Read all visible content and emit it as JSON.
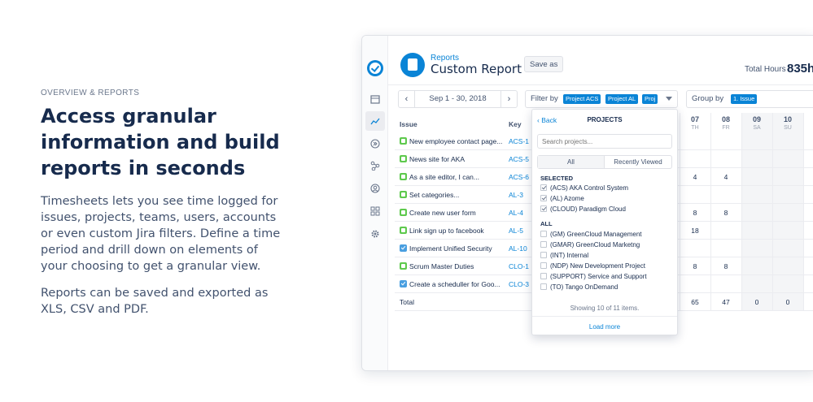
{
  "marketing": {
    "eyebrow": "OVERVIEW & REPORTS",
    "headline": "Access granular information and build reports in seconds",
    "paragraph1": "Timesheets lets you see time logged for issues, projects, teams, users, accounts or even custom Jira filters. Define a time period and drill down on elements of your choosing to get a granular view.",
    "paragraph2": "Reports can be saved and exported as XLS, CSV and PDF."
  },
  "app": {
    "breadcrumb": "Reports",
    "title": "Custom Report",
    "save_as": "Save as",
    "total_hours_label": "Total Hours",
    "total_hours_value": "835h",
    "date_range": "Sep 1 - 30, 2018",
    "filter_label": "Filter by",
    "filter_tags": [
      "Project ACS",
      "Project AL",
      "Proj"
    ],
    "group_label": "Group by",
    "group_tag": "1. Issue",
    "table": {
      "col_issue": "Issue",
      "col_key": "Key",
      "days": [
        {
          "num": "07",
          "name": "TH"
        },
        {
          "num": "08",
          "name": "FR"
        },
        {
          "num": "09",
          "name": "SA"
        },
        {
          "num": "10",
          "name": "SU"
        }
      ],
      "rows": [
        {
          "summary": "New employee contact page...",
          "key": "ACS-1",
          "type": "story",
          "d07": "",
          "d08": ""
        },
        {
          "summary": "News site for AKA",
          "key": "ACS-5",
          "type": "story",
          "d07": "",
          "d08": ""
        },
        {
          "summary": "As a site editor, I can...",
          "key": "ACS-6",
          "type": "story",
          "d07": "4",
          "d08": "4"
        },
        {
          "summary": "Set categories...",
          "key": "AL-3",
          "type": "story",
          "d07": "",
          "d08": ""
        },
        {
          "summary": "Create new user form",
          "key": "AL-4",
          "type": "story",
          "d07": "8",
          "d08": "8"
        },
        {
          "summary": "Link sign up to facebook",
          "key": "AL-5",
          "type": "story",
          "d07": "18",
          "d08": ""
        },
        {
          "summary": "Implement Unified Security",
          "key": "AL-10",
          "type": "task",
          "d07": "",
          "d08": ""
        },
        {
          "summary": "Scrum Master Duties",
          "key": "CLO-1",
          "type": "story",
          "d07": "8",
          "d08": "8"
        },
        {
          "summary": "Create a scheduller for Goo...",
          "key": "CLO-3",
          "type": "task",
          "d07": "",
          "d08": ""
        }
      ],
      "total_label": "Total",
      "totals": {
        "d07": "65",
        "d08": "47",
        "d09": "0",
        "d10": "0"
      }
    },
    "dropdown": {
      "back": "Back",
      "title": "PROJECTS",
      "search_placeholder": "Search projects...",
      "tab_all": "All",
      "tab_recent": "Recently Viewed",
      "selected_label": "SELECTED",
      "selected": [
        "(ACS) AKA Control System",
        "(AL) Azome",
        "(CLOUD) Paradigm Cloud"
      ],
      "all_label": "ALL",
      "all": [
        "(GM) GreenCloud Management",
        "(GMAR) GreenCloud Marketng",
        "(INT) Internal",
        "(NDP) New Development Project",
        "(SUPPORT) Service and Support",
        "(TO) Tango OnDemand"
      ],
      "showing": "Showing 10 of 11 items.",
      "load_more": "Load more"
    }
  },
  "colors": {
    "accent": "#0a84d6",
    "story": "#5ec94d",
    "task": "#4a9fe0"
  }
}
